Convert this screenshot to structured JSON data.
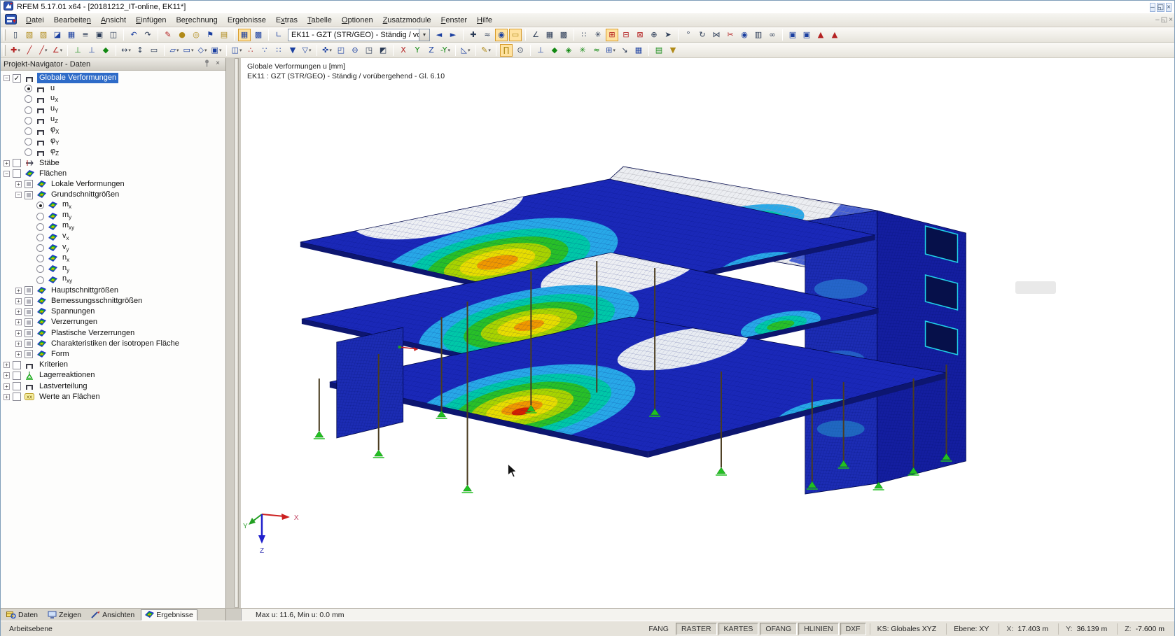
{
  "window": {
    "title": "RFEM 5.17.01 x64 - [20181212_IT-online, EK11*]",
    "controls": [
      {
        "n": "minimize-button",
        "g": "–"
      },
      {
        "n": "restore-button",
        "g": "◱"
      },
      {
        "n": "close-button",
        "g": "×"
      }
    ],
    "mdi_controls": [
      {
        "n": "mdi-minimize-button",
        "g": "–"
      },
      {
        "n": "mdi-restore-button",
        "g": "◱"
      },
      {
        "n": "mdi-close-button",
        "g": "×"
      }
    ]
  },
  "menubar": {
    "items": [
      {
        "label": "Datei",
        "u": 0
      },
      {
        "label": "Bearbeiten",
        "u": 9
      },
      {
        "label": "Ansicht",
        "u": 0
      },
      {
        "label": "Einfügen",
        "u": 0
      },
      {
        "label": "Berechnung",
        "u": 2
      },
      {
        "label": "Ergebnisse",
        "u": 2
      },
      {
        "label": "Extras",
        "u": 1
      },
      {
        "label": "Tabelle",
        "u": 0
      },
      {
        "label": "Optionen",
        "u": 0
      },
      {
        "label": "Zusatzmodule",
        "u": 0
      },
      {
        "label": "Fenster",
        "u": 0
      },
      {
        "label": "Hilfe",
        "u": 0
      }
    ]
  },
  "toolbar1": {
    "combo": {
      "value": "EK11 - GZT (STR/GEO) - Ständig / vorüb"
    },
    "groups_before": [
      [
        {
          "n": "new-document-icon",
          "g": "▯"
        },
        {
          "n": "open-file-icon",
          "g": "▧",
          "c": "y"
        },
        {
          "n": "open-project-icon",
          "g": "▨",
          "c": "y"
        },
        {
          "n": "open-model-icon",
          "g": "◪",
          "c": "b"
        },
        {
          "n": "save-icon",
          "g": "▦",
          "c": "b"
        },
        {
          "n": "notes-icon",
          "g": "≡"
        },
        {
          "n": "print-icon",
          "g": "▣"
        },
        {
          "n": "print-preview-icon",
          "g": "◫"
        }
      ],
      [
        {
          "n": "undo-icon",
          "g": "↶",
          "c": "b"
        },
        {
          "n": "redo-icon",
          "g": "↷"
        }
      ],
      [
        {
          "n": "edit-mode-icon",
          "g": "✎",
          "c": "r"
        },
        {
          "n": "show-load-labels-icon",
          "g": "●",
          "c": "y"
        },
        {
          "n": "show-result-labels-icon",
          "g": "◎",
          "c": "y"
        },
        {
          "n": "move-flag-icon",
          "g": "⚑",
          "c": "b"
        },
        {
          "n": "results-folder-icon",
          "g": "▤",
          "c": "y"
        }
      ],
      [
        {
          "n": "show-tables-icon",
          "g": "▦",
          "c": "b",
          "hl": true
        },
        {
          "n": "table-layout-icon",
          "g": "▩",
          "c": "b"
        }
      ],
      [
        {
          "n": "units-icon",
          "g": "∟",
          "c": "b"
        }
      ]
    ],
    "groups_after": [
      [
        {
          "n": "previous-loadcase-icon",
          "g": "◄",
          "c": "b"
        },
        {
          "n": "next-loadcase-icon",
          "g": "►",
          "c": "b"
        }
      ],
      [
        {
          "n": "point-coordinates-icon",
          "g": "✚"
        },
        {
          "n": "value-format-icon",
          "g": "≈"
        },
        {
          "n": "show-results-icon",
          "g": "◉",
          "c": "b",
          "hl": true
        },
        {
          "n": "show-result-values-icon",
          "g": "▭",
          "c": "y",
          "hl": true
        }
      ],
      [
        {
          "n": "deformation-scale-icon",
          "g": "∠"
        },
        {
          "n": "result-table-icon",
          "g": "▦"
        },
        {
          "n": "result-grid-icon",
          "g": "▩"
        }
      ],
      [
        {
          "n": "mesh-points-icon",
          "g": "∷"
        },
        {
          "n": "mesh-refine-icon",
          "g": "✳"
        },
        {
          "n": "clip-plane-x-icon",
          "g": "⊞",
          "c": "r",
          "hl": true
        },
        {
          "n": "clip-plane-y-icon",
          "g": "⊟",
          "c": "r"
        },
        {
          "n": "clip-plane-z-icon",
          "g": "⊠",
          "c": "r"
        },
        {
          "n": "clip-rotate-icon",
          "g": "⊕"
        },
        {
          "n": "selection-arrow-icon",
          "g": "➤"
        }
      ],
      [
        {
          "n": "probe-icon",
          "g": "°"
        },
        {
          "n": "rotate-view-icon",
          "g": "↻"
        },
        {
          "n": "mirror-icon",
          "g": "⋈"
        },
        {
          "n": "cut-icon",
          "g": "✂",
          "c": "r"
        },
        {
          "n": "info-icon",
          "g": "◉",
          "c": "b"
        },
        {
          "n": "report-icon",
          "g": "▥"
        },
        {
          "n": "modules-icon",
          "g": "∞"
        }
      ],
      [
        {
          "n": "printout-report-icon",
          "g": "▣",
          "c": "b"
        },
        {
          "n": "printout-report2-icon",
          "g": "▣",
          "c": "b"
        },
        {
          "n": "quick-print-icon",
          "g": "▲",
          "c": "r"
        },
        {
          "n": "export-pdf-icon",
          "g": "▲",
          "c": "r"
        }
      ]
    ]
  },
  "toolbar2": {
    "groups": [
      [
        {
          "n": "new-node-icon",
          "g": "✚",
          "c": "r",
          "dd": true
        },
        {
          "n": "new-line-icon",
          "g": "╱",
          "c": "r"
        },
        {
          "n": "new-line-dimension-icon",
          "g": "╱",
          "c": "r",
          "dd": true
        },
        {
          "n": "new-polyline-icon",
          "g": "∠",
          "c": "r",
          "dd": true
        }
      ],
      [
        {
          "n": "new-member-icon",
          "g": "⊥",
          "c": "g"
        },
        {
          "n": "new-member-set-icon",
          "g": "⊥",
          "c": "b"
        },
        {
          "n": "new-surface-icon",
          "g": "◆",
          "c": "g"
        }
      ],
      [
        {
          "n": "dimension-icon",
          "g": "↔",
          "dd": true
        },
        {
          "n": "auxiliary-dimension-icon",
          "g": "↕"
        },
        {
          "n": "dimension-frame-icon",
          "g": "▭"
        }
      ],
      [
        {
          "n": "new-surface-blue-icon",
          "g": "▱",
          "c": "b",
          "dd": true
        },
        {
          "n": "new-opening-icon",
          "g": "▭",
          "c": "b",
          "dd": true
        },
        {
          "n": "new-solid-icon",
          "g": "◇",
          "c": "b",
          "dd": true
        },
        {
          "n": "new-block-icon",
          "g": "▣",
          "c": "b",
          "dd": true
        }
      ],
      [
        {
          "n": "copy-object-icon",
          "g": "◫",
          "c": "b",
          "dd": true
        },
        {
          "n": "generated-nodes-icon",
          "g": "∴",
          "c": "r"
        },
        {
          "n": "array-copy-icon",
          "g": "∵",
          "c": "b"
        },
        {
          "n": "array-copy2-icon",
          "g": "∷",
          "c": "b"
        },
        {
          "n": "block-save-icon",
          "g": "▼",
          "c": "b"
        },
        {
          "n": "block-insert-icon",
          "g": "▽",
          "c": "b",
          "dd": true
        }
      ],
      [
        {
          "n": "zoom-pan-icon",
          "g": "✜",
          "c": "b",
          "dd": true
        },
        {
          "n": "zoom-window-icon",
          "g": "◰",
          "c": "b"
        },
        {
          "n": "zoom-out-icon",
          "g": "⊖",
          "c": "b"
        },
        {
          "n": "isometric-view-icon",
          "g": "◳"
        },
        {
          "n": "cube-faces-icon",
          "g": "◩"
        }
      ],
      [
        {
          "n": "view-x-icon",
          "g": "X",
          "c": "r"
        },
        {
          "n": "view-y-icon",
          "g": "Y",
          "c": "g"
        },
        {
          "n": "view-z-icon",
          "g": "Z",
          "c": "b"
        },
        {
          "n": "view-minus-y-icon",
          "g": "-Y",
          "c": "g",
          "dd": true
        }
      ],
      [
        {
          "n": "work-plane-icon",
          "g": "◺",
          "c": "b",
          "dd": true
        }
      ],
      [
        {
          "n": "sketch-plane-icon",
          "g": "✎",
          "c": "y",
          "dd": true
        }
      ],
      [
        {
          "n": "panel-toggle-icon",
          "g": "∏",
          "c": "y",
          "hl": true
        },
        {
          "n": "comment-icon",
          "g": "⊙"
        }
      ],
      [
        {
          "n": "axes-tool-icon",
          "g": "⊥",
          "c": "b"
        },
        {
          "n": "results-surface-icon",
          "g": "◆",
          "c": "g"
        },
        {
          "n": "results-solid-icon",
          "g": "◈",
          "c": "g"
        },
        {
          "n": "supports-icon",
          "g": "✳",
          "c": "g"
        },
        {
          "n": "smooth-results-icon",
          "g": "≈",
          "c": "g"
        },
        {
          "n": "blocks-grid-icon",
          "g": "⊞",
          "c": "b",
          "dd": true
        },
        {
          "n": "move-handle-icon",
          "g": "↘"
        },
        {
          "n": "big-tables-icon",
          "g": "▦",
          "c": "b"
        }
      ],
      [
        {
          "n": "color-rows-icon",
          "g": "▤",
          "c": "g"
        },
        {
          "n": "gradient-scale-icon",
          "g": "▼",
          "c": "y"
        }
      ]
    ]
  },
  "navigator": {
    "title": "Projekt-Navigator - Daten",
    "tree": [
      {
        "label": "Globale Verformungen",
        "level": 0,
        "expand": "minus",
        "check": "on",
        "icon": "staple",
        "selected": true
      },
      {
        "label": "u",
        "level": 1,
        "radio": true,
        "icon": "staple"
      },
      {
        "label": "u",
        "sub": "X",
        "level": 1,
        "radio": false,
        "icon": "staple"
      },
      {
        "label": "u",
        "sub": "Y",
        "level": 1,
        "radio": false,
        "icon": "staple"
      },
      {
        "label": "u",
        "sub": "Z",
        "level": 1,
        "radio": false,
        "icon": "staple"
      },
      {
        "label": "φ",
        "sub": "X",
        "level": 1,
        "radio": false,
        "icon": "staple"
      },
      {
        "label": "φ",
        "sub": "Y",
        "level": 1,
        "radio": false,
        "icon": "staple"
      },
      {
        "label": "φ",
        "sub": "Z",
        "level": 1,
        "radio": false,
        "icon": "staple"
      },
      {
        "label": "Stäbe",
        "level": 0,
        "expand": "plus",
        "check": "off",
        "icon": "member"
      },
      {
        "label": "Flächen",
        "level": 0,
        "expand": "minus",
        "check": "off",
        "icon": "surface"
      },
      {
        "label": "Lokale Verformungen",
        "level": 1,
        "expand": "plus",
        "check": "partial",
        "icon": "surface"
      },
      {
        "label": "Grundschnittgrößen",
        "level": 1,
        "expand": "minus",
        "check": "partial",
        "icon": "surface"
      },
      {
        "label": "m",
        "sub": "x",
        "level": 2,
        "radio": true,
        "icon": "surface"
      },
      {
        "label": "m",
        "sub": "y",
        "level": 2,
        "radio": false,
        "icon": "surface"
      },
      {
        "label": "m",
        "sub": "xy",
        "level": 2,
        "radio": false,
        "icon": "surface"
      },
      {
        "label": "v",
        "sub": "x",
        "level": 2,
        "radio": false,
        "icon": "surface"
      },
      {
        "label": "v",
        "sub": "y",
        "level": 2,
        "radio": false,
        "icon": "surface"
      },
      {
        "label": "n",
        "sub": "x",
        "level": 2,
        "radio": false,
        "icon": "surface"
      },
      {
        "label": "n",
        "sub": "y",
        "level": 2,
        "radio": false,
        "icon": "surface"
      },
      {
        "label": "n",
        "sub": "xy",
        "level": 2,
        "radio": false,
        "icon": "surface"
      },
      {
        "label": "Hauptschnittgrößen",
        "level": 1,
        "expand": "plus",
        "check": "partial",
        "icon": "surface"
      },
      {
        "label": "Bemessungsschnittgrößen",
        "level": 1,
        "expand": "plus",
        "check": "partial",
        "icon": "surface"
      },
      {
        "label": "Spannungen",
        "level": 1,
        "expand": "plus",
        "check": "partial",
        "icon": "surface"
      },
      {
        "label": "Verzerrungen",
        "level": 1,
        "expand": "plus",
        "check": "partial",
        "icon": "surface"
      },
      {
        "label": "Plastische Verzerrungen",
        "level": 1,
        "expand": "plus",
        "check": "partial",
        "icon": "surface"
      },
      {
        "label": "Charakteristiken der isotropen Fläche",
        "level": 1,
        "expand": "plus",
        "check": "partial",
        "icon": "surface"
      },
      {
        "label": "Form",
        "level": 1,
        "expand": "plus",
        "check": "partial",
        "icon": "surface"
      },
      {
        "label": "Kriterien",
        "level": 0,
        "expand": "plus",
        "check": "off",
        "icon": "staple"
      },
      {
        "label": "Lagerreaktionen",
        "level": 0,
        "expand": "plus",
        "check": "off",
        "icon": "support"
      },
      {
        "label": "Lastverteilung",
        "level": 0,
        "expand": "plus",
        "check": "off",
        "icon": "staple"
      },
      {
        "label": "Werte an Flächen",
        "level": 0,
        "expand": "plus",
        "check": "off",
        "icon": "values"
      }
    ],
    "tabs": [
      {
        "label": "Daten",
        "icon": "daten",
        "active": false
      },
      {
        "label": "Zeigen",
        "icon": "zeigen",
        "active": false
      },
      {
        "label": "Ansichten",
        "icon": "ansichten",
        "active": false
      },
      {
        "label": "Ergebnisse",
        "icon": "ergebnisse",
        "active": true
      }
    ]
  },
  "viewport": {
    "header_line1": "Globale Verformungen u [mm]",
    "header_line2": "EK11 : GZT (STR/GEO) - Ständig / vorübergehend - Gl. 6.10",
    "result_summary": "Max u: 11.6, Min u: 0.0 mm",
    "axes": {
      "x": "X",
      "y": "Y",
      "z": "Z"
    }
  },
  "statusbar": {
    "left": "Arbeitsebene",
    "toggles": [
      {
        "label": "FANG",
        "pressed": false
      },
      {
        "label": "RASTER",
        "pressed": true
      },
      {
        "label": "KARTES",
        "pressed": true
      },
      {
        "label": "OFANG",
        "pressed": true
      },
      {
        "label": "HLINIEN",
        "pressed": true
      },
      {
        "label": "DXF",
        "pressed": true
      }
    ],
    "ks": "KS: Globales XYZ",
    "plane": "Ebene: XY",
    "coords": [
      {
        "l": "X:",
        "v": "17.403 m"
      },
      {
        "l": "Y:",
        "v": "36.139 m"
      },
      {
        "l": "Z:",
        "v": "-7.600 m"
      }
    ]
  },
  "colors": {
    "selection": "#2e6bc8",
    "support_green": "#22c022",
    "deform_scale": [
      "#1a28b8",
      "#28a8e8",
      "#00c8a8",
      "#28c028",
      "#a8d400",
      "#e8de00",
      "#f09800",
      "#d42000"
    ]
  }
}
